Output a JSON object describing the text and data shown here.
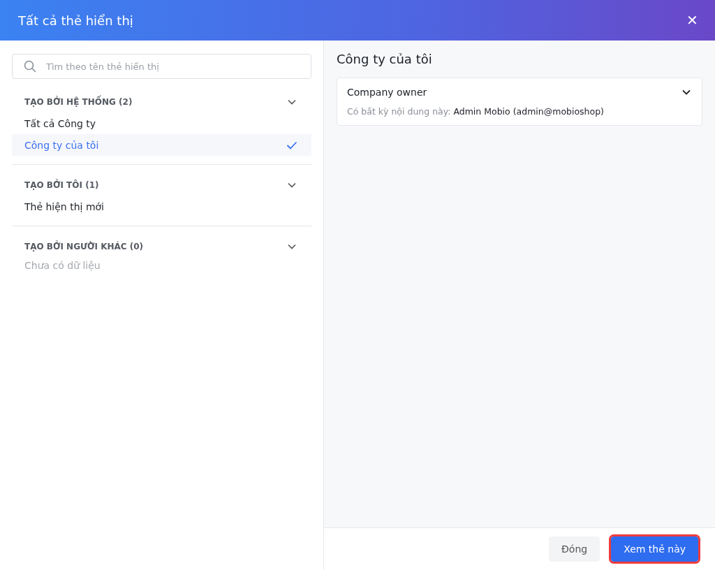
{
  "window": {
    "title": "Tất cả thẻ hiển thị",
    "close": "✕"
  },
  "search": {
    "placeholder": "Tìm theo tên thẻ hiển thị"
  },
  "groups": [
    {
      "title": "TẠO BỞI HỆ THỐNG (2)",
      "items": [
        {
          "label": "Tất cả Công ty",
          "selected": false
        },
        {
          "label": "Công ty của tôi",
          "selected": true
        }
      ]
    },
    {
      "title": "TẠO BỞI TÔI (1)",
      "items": [
        {
          "label": "Thẻ hiện thị mới",
          "selected": false
        }
      ]
    },
    {
      "title": "TẠO BỞI NGƯỜI KHÁC (0)",
      "empty_text": "Chưa có dữ liệu"
    }
  ],
  "detail": {
    "title": "Công ty của tôi",
    "cards": [
      {
        "title": "Company owner",
        "condition": "Có bất kỳ nội dung này: **Admin Mobio (admin@mobioshop)**"
      }
    ]
  },
  "buttons": [
    {
      "label": "Đóng",
      "kind": "secondary",
      "highlighted": false
    },
    {
      "label": "Xem thẻ này",
      "kind": "primary",
      "highlighted": true
    }
  ]
}
